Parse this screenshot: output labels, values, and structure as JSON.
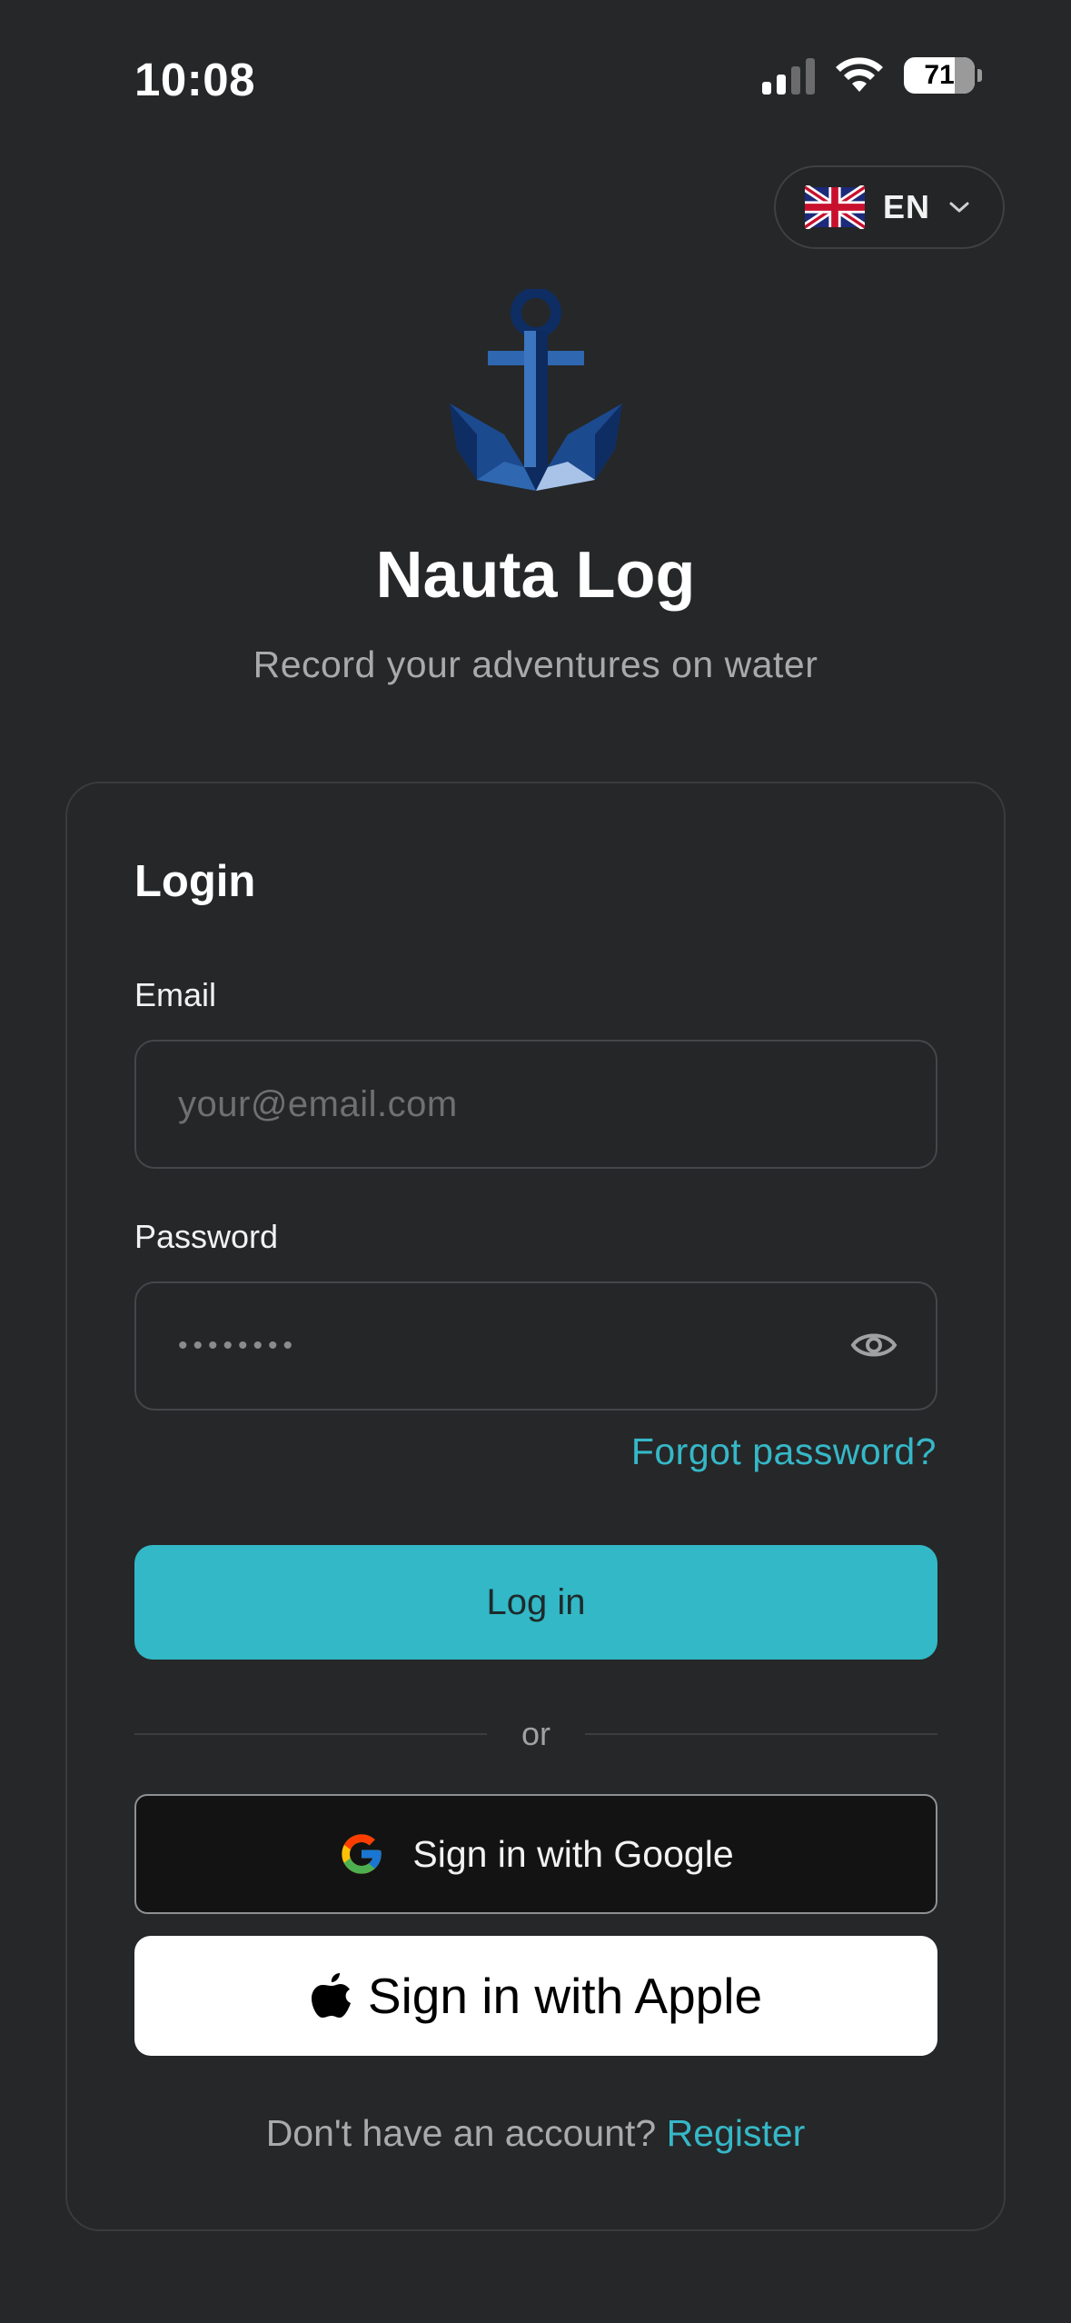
{
  "status_bar": {
    "time": "10:08",
    "battery": "71"
  },
  "language": {
    "code": "EN",
    "flag": "uk-flag-icon"
  },
  "app": {
    "title": "Nauta Log",
    "subtitle": "Record your adventures on water"
  },
  "login": {
    "title": "Login",
    "email_label": "Email",
    "email_placeholder": "your@email.com",
    "password_label": "Password",
    "password_placeholder": "••••••••",
    "forgot_password": "Forgot password?",
    "login_button": "Log in",
    "or": "or",
    "google_button": "Sign in with Google",
    "apple_button": "Sign in with Apple",
    "register_question": "Don't have an account?",
    "register_link": "Register"
  },
  "colors": {
    "background": "#262728",
    "accent": "#32b8c6",
    "link": "#35b8c8"
  }
}
